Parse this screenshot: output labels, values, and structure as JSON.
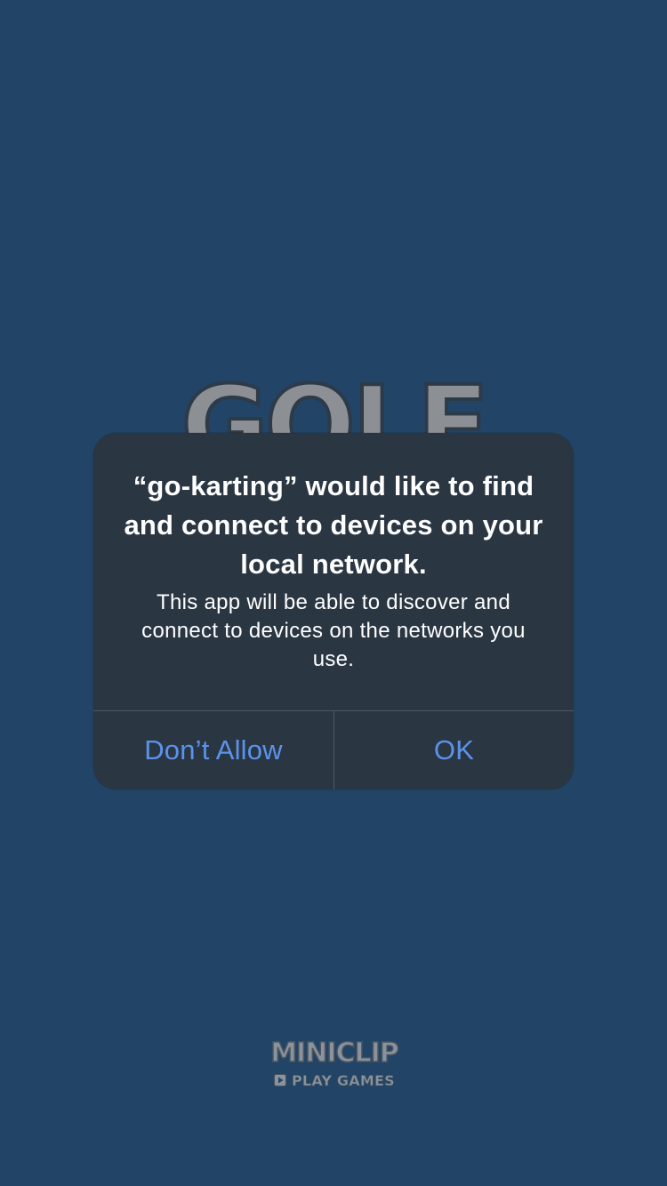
{
  "app": {
    "background_color": "#224466",
    "logo_text": "GOLF"
  },
  "alert": {
    "title": "“go-karting” would like to find and connect to devices on your local network.",
    "message": "This app will be able to discover and connect to devices on the networks you use.",
    "buttons": {
      "deny_label": "Don’t Allow",
      "ok_label": "OK"
    },
    "colors": {
      "background": "#2b3643",
      "button_text": "#5b93ec",
      "divider": "#4d5966"
    }
  },
  "publisher": {
    "name": "MINICLIP",
    "tagline": "PLAY GAMES",
    "icon": "play-icon"
  }
}
